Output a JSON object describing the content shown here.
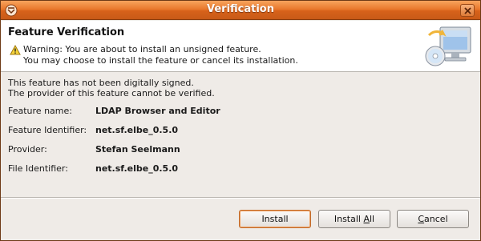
{
  "window": {
    "title": "Verification"
  },
  "banner": {
    "title": "Feature Verification",
    "warning_line1": "Warning: You are about to install an unsigned feature.",
    "warning_line2": "You may choose to install the feature or cancel its installation."
  },
  "message": {
    "line1": "This feature has not been digitally signed.",
    "line2": "The provider of this feature cannot be verified."
  },
  "details": [
    {
      "label": "Feature name:",
      "value": "LDAP Browser and Editor"
    },
    {
      "label": "Feature Identifier:",
      "value": "net.sf.elbe_0.5.0"
    },
    {
      "label": "Provider:",
      "value": "Stefan Seelmann"
    },
    {
      "label": "File Identifier:",
      "value": "net.sf.elbe_0.5.0"
    }
  ],
  "buttons": {
    "install": "Install",
    "install_all_prefix": "Install ",
    "install_all_mnemonic": "A",
    "install_all_suffix": "ll",
    "cancel_mnemonic": "C",
    "cancel_suffix": "ancel"
  },
  "colors": {
    "titlebar": "#e9792d",
    "dialog_bg": "#efebe7",
    "banner_bg": "#ffffff"
  },
  "icons": [
    "window-menu-icon",
    "close-icon",
    "warning-icon",
    "install-monitor-icon"
  ]
}
